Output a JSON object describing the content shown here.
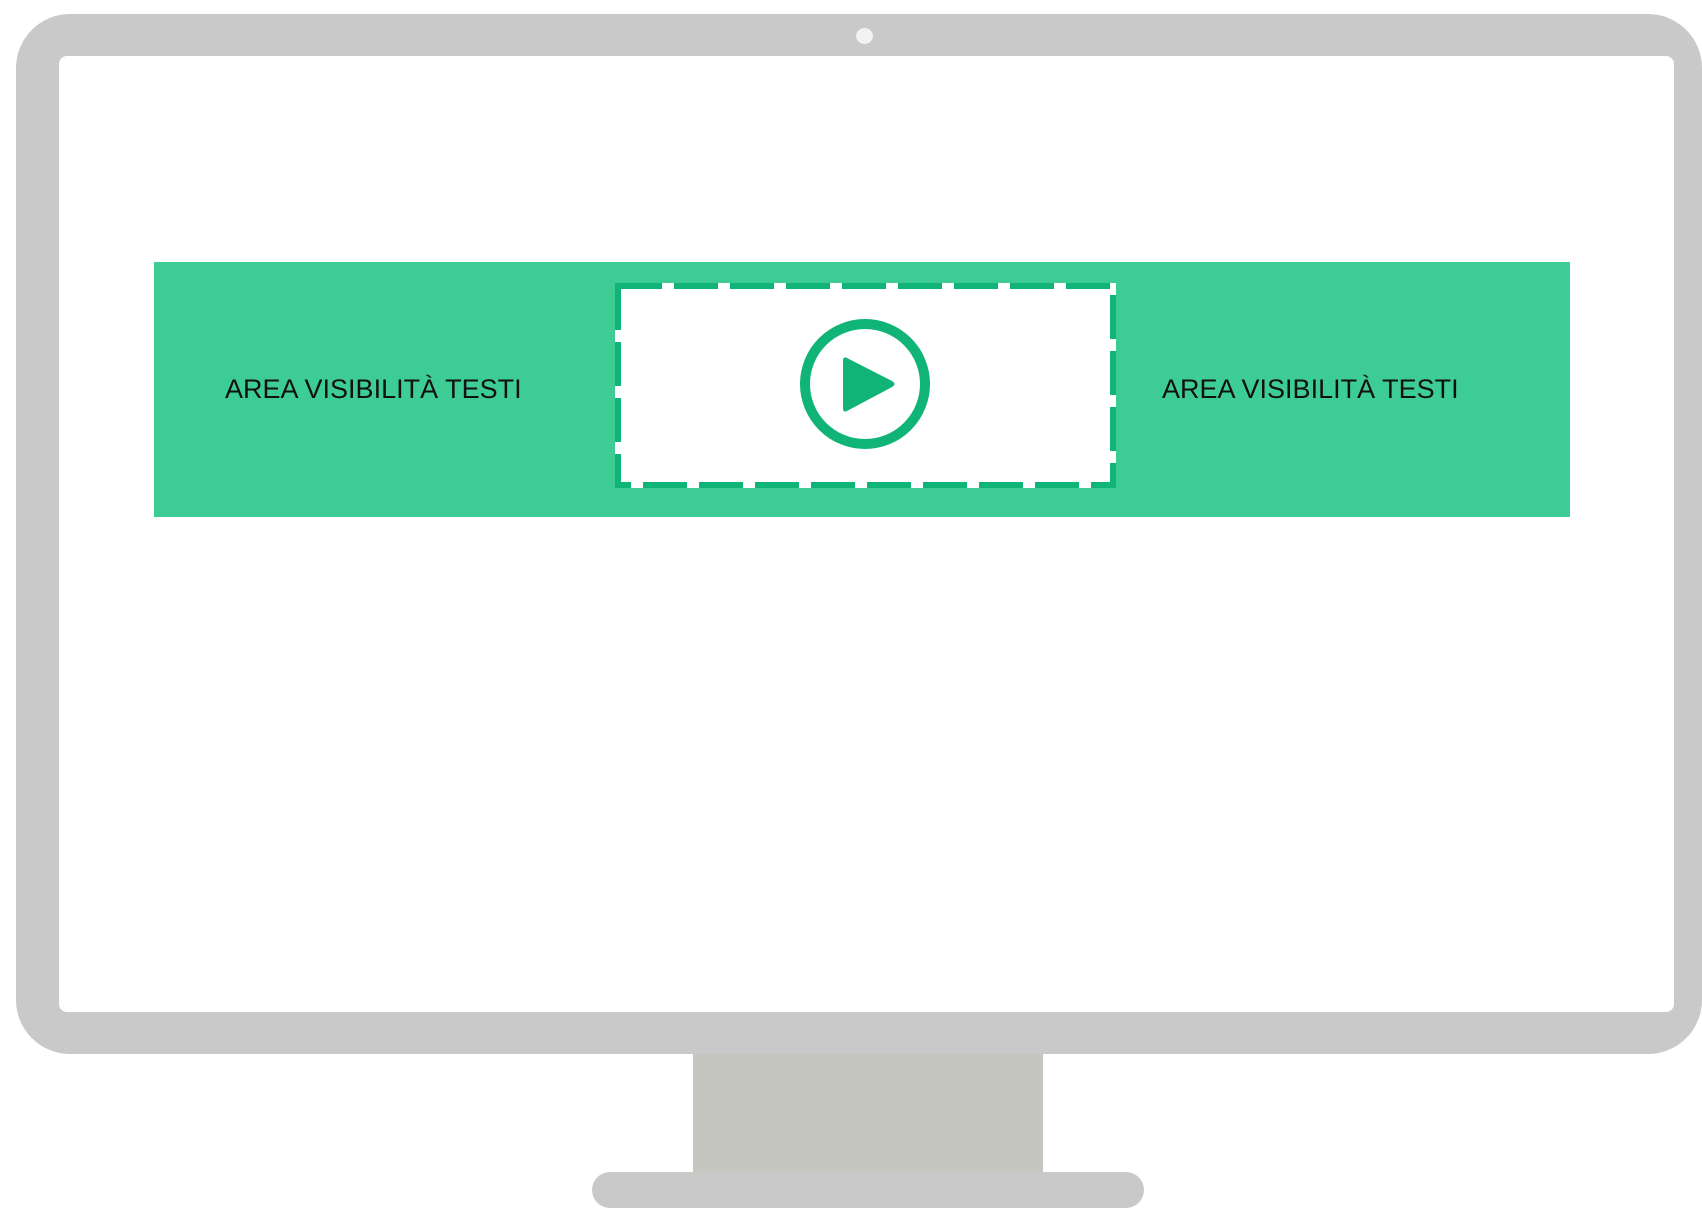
{
  "banner": {
    "left_text": "AREA VISIBILITÀ TESTI",
    "right_text": "AREA VISIBILITÀ TESTI"
  },
  "colors": {
    "banner_green": "#3ecc95",
    "accent_green": "#0fb476",
    "monitor_gray": "#c9c9c9",
    "stand_gray": "#c6c6c1"
  },
  "icons": {
    "video": "play-icon"
  }
}
